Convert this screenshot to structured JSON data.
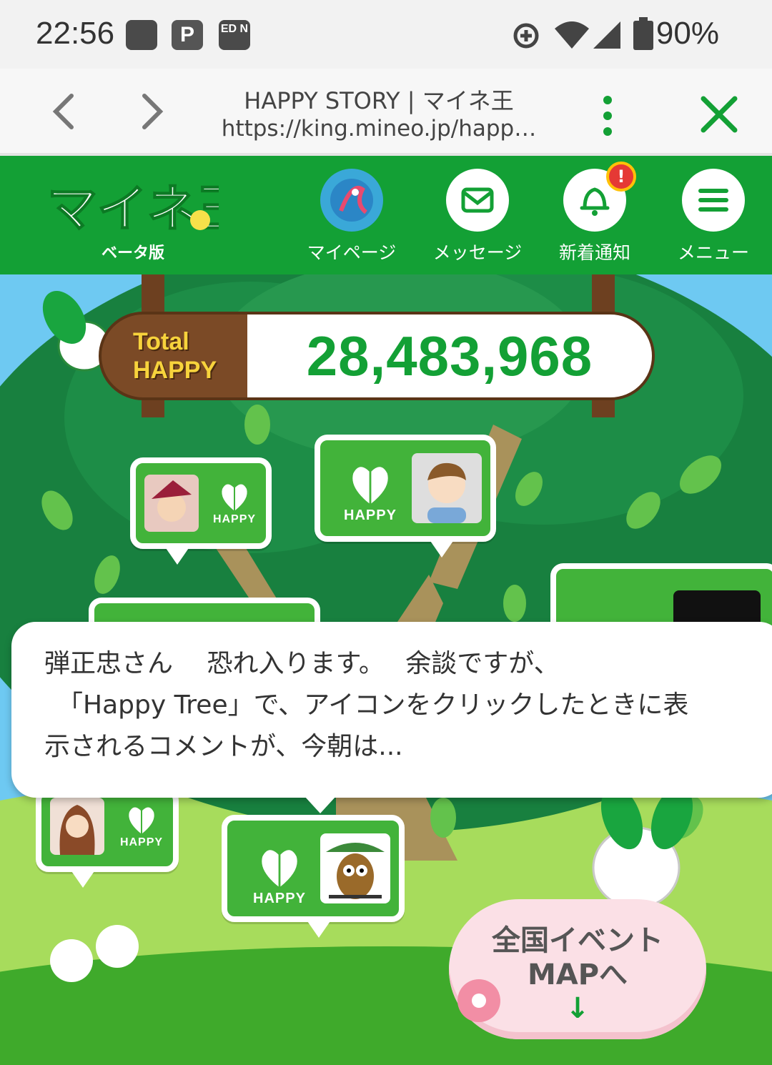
{
  "status_bar": {
    "time": "22:56",
    "icons": [
      "square-icon",
      "paypay-icon",
      "edn-icon"
    ],
    "edn_text": "ED N",
    "battery": "90%"
  },
  "browser": {
    "title": "HAPPY STORY | マイネ王",
    "url": "https://king.mineo.jp/happ…"
  },
  "site_header": {
    "logo_text": "マイネ王",
    "beta": "ベータ版",
    "nav": [
      {
        "label": "マイページ",
        "icon": "avatar-icon"
      },
      {
        "label": "メッセージ",
        "icon": "envelope-icon"
      },
      {
        "label": "新着通知",
        "icon": "bell-icon",
        "badge": "!"
      },
      {
        "label": "メニュー",
        "icon": "hamburger-icon"
      }
    ]
  },
  "counter": {
    "label_line1": "Total",
    "label_line2": "HAPPY",
    "value": "28,483,968"
  },
  "happy_cards": [
    {
      "word": "HAPPY"
    },
    {
      "word": "HAPPY"
    },
    {
      "word": "HAPPY"
    },
    {
      "word": "HAPPY"
    }
  ],
  "tooltip": {
    "text_line1": "弾正忠さん　 恐れ入ります。　 余談ですが、",
    "text_line2": "　「Happy Tree」で、アイコンをクリックしたときに表",
    "text_line3": "示されるコメントが、今朝は..."
  },
  "event_button": {
    "line1": "全国イベント",
    "line2": "MAPへ",
    "arrow": "↓"
  },
  "colors": {
    "brand_green": "#13a035",
    "card_green": "#42b33a",
    "counter_brown": "#7b4a26",
    "event_pink": "#fbe0e6"
  }
}
